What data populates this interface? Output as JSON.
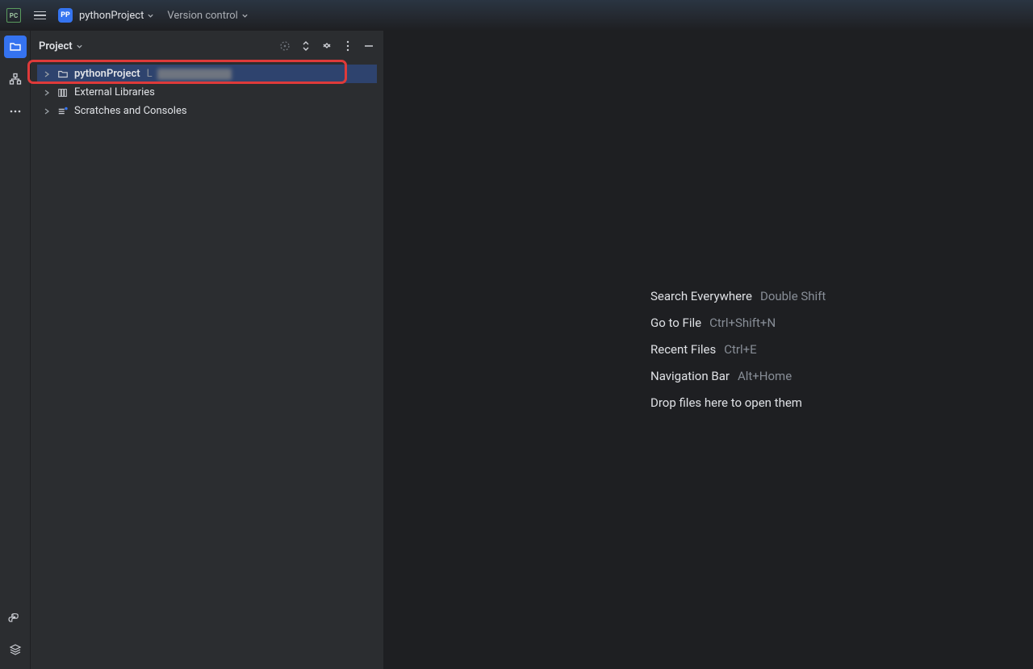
{
  "topbar": {
    "app_icon_text": "PC",
    "project_badge": "PP",
    "project_name": "pythonProject",
    "vcs_label": "Version control"
  },
  "panel": {
    "title": "Project"
  },
  "tree": {
    "root": {
      "name": "pythonProject",
      "path_prefix": "L"
    },
    "external": "External Libraries",
    "scratches": "Scratches and Consoles"
  },
  "hints": {
    "rows": [
      {
        "label": "Search Everywhere",
        "shortcut": "Double Shift"
      },
      {
        "label": "Go to File",
        "shortcut": "Ctrl+Shift+N"
      },
      {
        "label": "Recent Files",
        "shortcut": "Ctrl+E"
      },
      {
        "label": "Navigation Bar",
        "shortcut": "Alt+Home"
      }
    ],
    "drop_text": "Drop files here to open them"
  }
}
